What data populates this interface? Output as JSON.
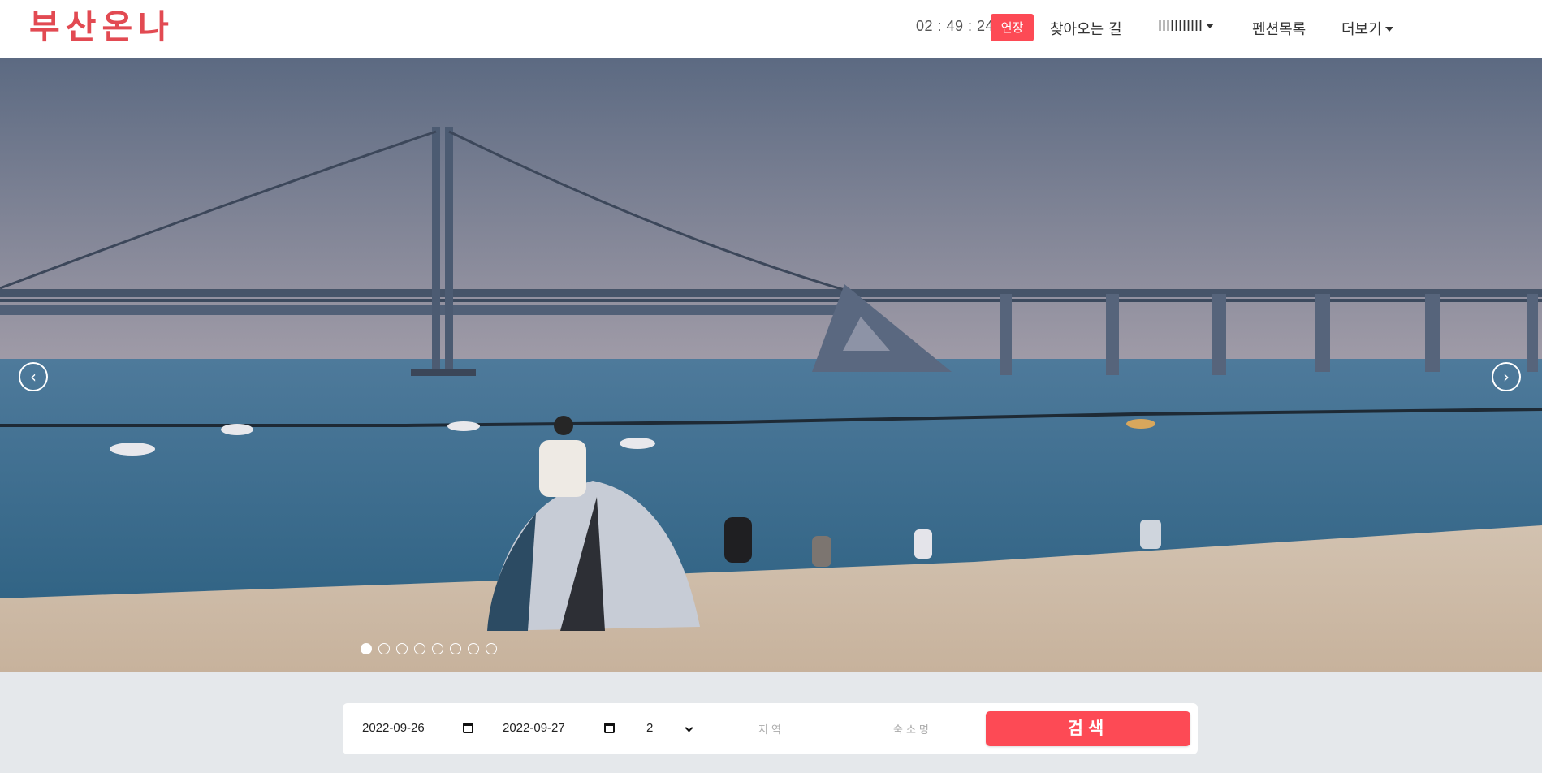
{
  "header": {
    "logo": "부산온나",
    "timer": "02 : 49 : 24",
    "extend_label": "연장",
    "nav": [
      {
        "label": "찾아오는 길"
      },
      {
        "label": "IIIIIIIIIII"
      },
      {
        "label": "펜션목록"
      },
      {
        "label": "더보기"
      }
    ]
  },
  "hero": {
    "slide_count": 8,
    "active_slide": 1,
    "prev_icon": "chevron-left-icon",
    "next_icon": "chevron-right-icon"
  },
  "search": {
    "checkin": "2022-09-26",
    "checkout": "2022-09-27",
    "guests": "2",
    "region_placeholder": "지역",
    "name_placeholder": "숙소명",
    "button_label": "검색"
  },
  "colors": {
    "brand": "#e24a52",
    "button": "#fd4a55",
    "sky": "#8d95a8",
    "sea": "#3e6f92",
    "sand": "#cdbba7"
  }
}
